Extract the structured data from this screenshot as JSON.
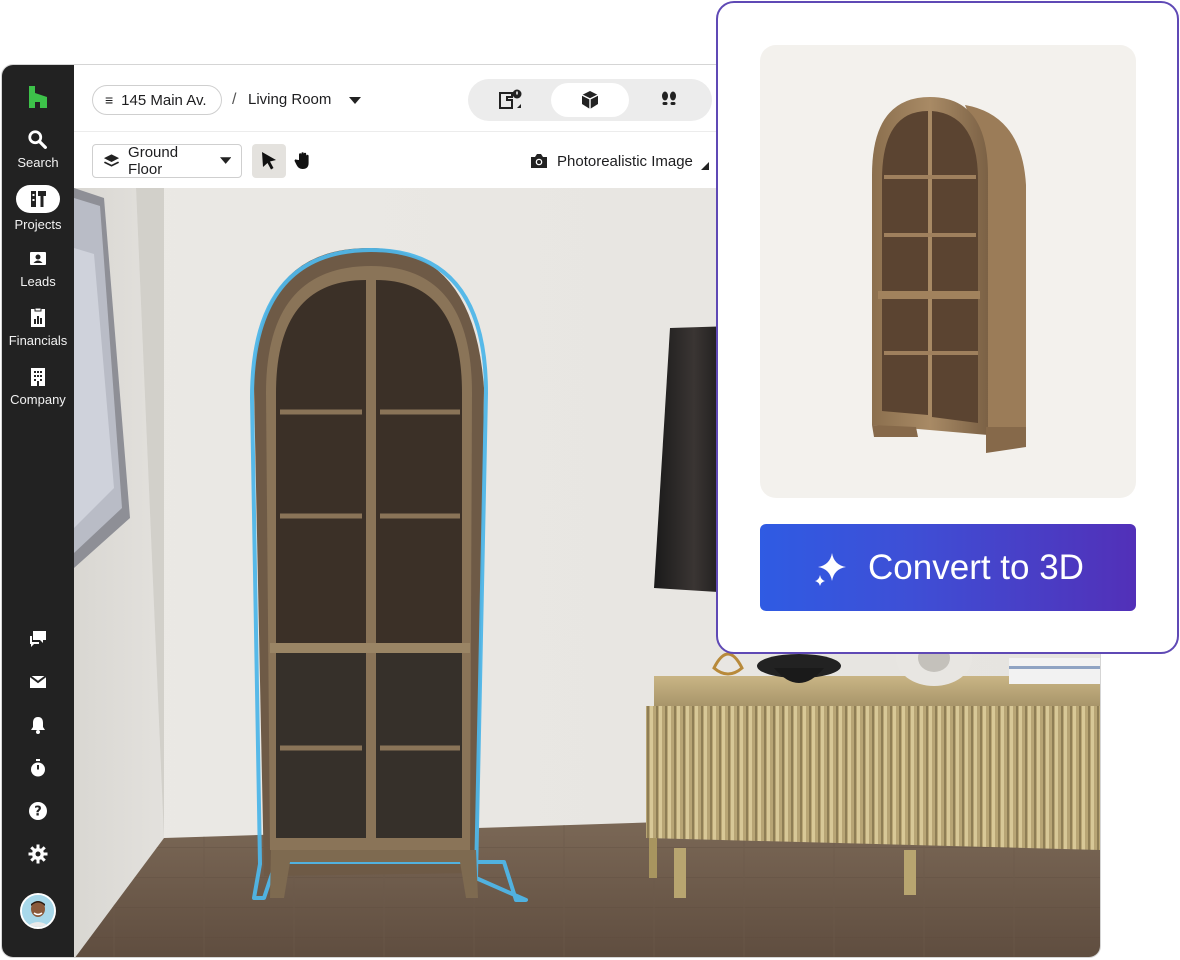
{
  "sidebar": {
    "items": [
      {
        "label": "Search",
        "icon": "search-icon"
      },
      {
        "label": "Projects",
        "icon": "hammer-icon"
      },
      {
        "label": "Leads",
        "icon": "contact-card-icon"
      },
      {
        "label": "Financials",
        "icon": "invoice-icon"
      },
      {
        "label": "Company",
        "icon": "building-icon"
      }
    ],
    "utility_icons": [
      "chat-icon",
      "inbox-icon",
      "bell-icon",
      "timer-icon",
      "help-icon",
      "settings-icon"
    ]
  },
  "topbar": {
    "project": "145 Main Av.",
    "separator": "/",
    "room": "Living Room",
    "views": [
      "floorplan-icon",
      "3d-box-icon",
      "walkthrough-icon"
    ]
  },
  "toolbar": {
    "floor": "Ground Floor",
    "render_label": "Photorealistic Image"
  },
  "card": {
    "button_label": "Convert to 3D"
  },
  "colors": {
    "sidebar_bg": "#222222",
    "brand_green": "#3dc24a",
    "selection_outline": "#4fb6e8",
    "card_border": "#5f49b5",
    "button_gradient_start": "#2f5be3",
    "button_gradient_end": "#5230b8"
  }
}
